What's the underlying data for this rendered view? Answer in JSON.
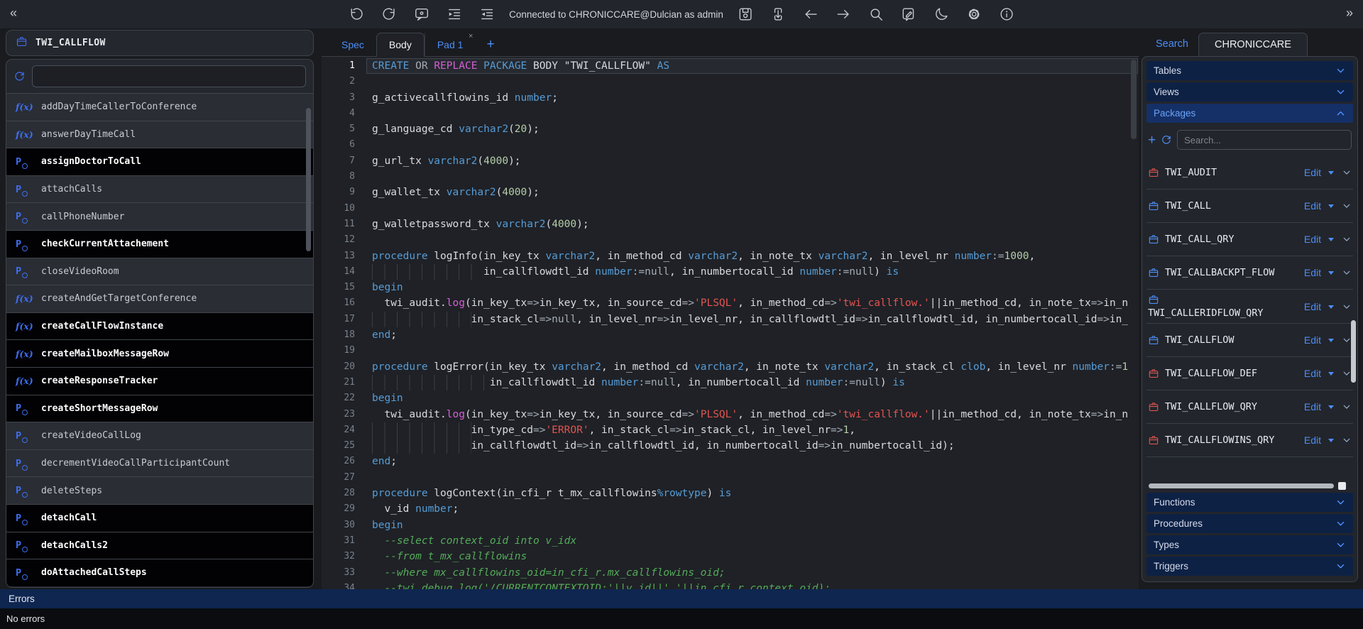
{
  "toolbar": {
    "collapse_left": "«",
    "collapse_right": "»",
    "connection_text": "Connected to CHRONICCARE@Dulcian as admin",
    "left_icons": [
      {
        "name": "undo-icon",
        "glyph": "undo"
      },
      {
        "name": "redo-icon",
        "glyph": "redo"
      },
      {
        "name": "comments-icon",
        "glyph": "comment"
      },
      {
        "name": "indent-icon",
        "glyph": "indent"
      },
      {
        "name": "outdent-icon",
        "glyph": "outdent"
      }
    ],
    "right_icons": [
      {
        "name": "save-icon",
        "glyph": "save"
      },
      {
        "name": "export-file-icon",
        "glyph": "docarrow"
      },
      {
        "name": "back-icon",
        "glyph": "arrowLeft"
      },
      {
        "name": "forward-icon",
        "glyph": "arrowRight"
      },
      {
        "name": "search-icon",
        "glyph": "search"
      },
      {
        "name": "annotate-icon",
        "glyph": "annotate"
      },
      {
        "name": "dark-mode-icon",
        "glyph": "moon"
      },
      {
        "name": "settings-icon",
        "glyph": "gear"
      },
      {
        "name": "info-icon",
        "glyph": "info"
      }
    ]
  },
  "left_panel": {
    "title": "TWI_CALLFLOW",
    "filter_value": "",
    "items": [
      {
        "label": "addDayTimeCallerToConference",
        "kind": "function",
        "emphasized": false
      },
      {
        "label": "answerDayTimeCall",
        "kind": "function",
        "emphasized": false
      },
      {
        "label": "assignDoctorToCall",
        "kind": "procedure",
        "emphasized": true
      },
      {
        "label": "attachCalls",
        "kind": "procedure",
        "emphasized": false
      },
      {
        "label": "callPhoneNumber",
        "kind": "procedure",
        "emphasized": false
      },
      {
        "label": "checkCurrentAttachement",
        "kind": "procedure",
        "emphasized": true
      },
      {
        "label": "closeVideoRoom",
        "kind": "procedure",
        "emphasized": false
      },
      {
        "label": "createAndGetTargetConference",
        "kind": "function",
        "emphasized": false
      },
      {
        "label": "createCallFlowInstance",
        "kind": "function",
        "emphasized": true
      },
      {
        "label": "createMailboxMessageRow",
        "kind": "function",
        "emphasized": true
      },
      {
        "label": "createResponseTracker",
        "kind": "function",
        "emphasized": true
      },
      {
        "label": "createShortMessageRow",
        "kind": "procedure",
        "emphasized": true
      },
      {
        "label": "createVideoCallLog",
        "kind": "procedure",
        "emphasized": false
      },
      {
        "label": "decrementVideoCallParticipantCount",
        "kind": "procedure",
        "emphasized": false
      },
      {
        "label": "deleteSteps",
        "kind": "procedure",
        "emphasized": false
      },
      {
        "label": "detachCall",
        "kind": "procedure",
        "emphasized": true
      },
      {
        "label": "detachCalls2",
        "kind": "procedure",
        "emphasized": true
      },
      {
        "label": "doAttachedCallSteps",
        "kind": "procedure",
        "emphasized": true
      }
    ]
  },
  "editor": {
    "tabs": [
      {
        "label": "Spec",
        "active": false
      },
      {
        "label": "Body",
        "active": true
      },
      {
        "label": "Pad 1",
        "active": false,
        "closable": true
      }
    ],
    "add_tab": "+",
    "close_glyph": "×",
    "lines": [
      {
        "no": 1,
        "current": true,
        "segs": [
          [
            "k",
            "CREATE"
          ],
          [
            "d",
            " "
          ],
          [
            "o",
            "OR"
          ],
          [
            "d",
            " "
          ],
          [
            "m",
            "REPLACE"
          ],
          [
            "d",
            " "
          ],
          [
            "k",
            "PACKAGE"
          ],
          [
            "d",
            " BODY \"TWI_CALLFLOW\" "
          ],
          [
            "k",
            "AS"
          ]
        ]
      },
      {
        "no": 2,
        "segs": []
      },
      {
        "no": 3,
        "segs": [
          [
            "d",
            "g_activecallflowins_id "
          ],
          [
            "k",
            "number"
          ],
          [
            "d",
            ";"
          ]
        ]
      },
      {
        "no": 4,
        "segs": []
      },
      {
        "no": 5,
        "segs": [
          [
            "d",
            "g_language_cd "
          ],
          [
            "k",
            "varchar2"
          ],
          [
            "d",
            "("
          ],
          [
            "n",
            "20"
          ],
          [
            "d",
            ");"
          ]
        ]
      },
      {
        "no": 6,
        "segs": []
      },
      {
        "no": 7,
        "segs": [
          [
            "d",
            "g_url_tx "
          ],
          [
            "k",
            "varchar2"
          ],
          [
            "d",
            "("
          ],
          [
            "n",
            "4000"
          ],
          [
            "d",
            ");"
          ]
        ]
      },
      {
        "no": 8,
        "segs": []
      },
      {
        "no": 9,
        "segs": [
          [
            "d",
            "g_wallet_tx "
          ],
          [
            "k",
            "varchar2"
          ],
          [
            "d",
            "("
          ],
          [
            "n",
            "4000"
          ],
          [
            "d",
            ");"
          ]
        ]
      },
      {
        "no": 10,
        "segs": []
      },
      {
        "no": 11,
        "segs": [
          [
            "d",
            "g_walletpassword_tx "
          ],
          [
            "k",
            "varchar2"
          ],
          [
            "d",
            "("
          ],
          [
            "n",
            "4000"
          ],
          [
            "d",
            ");"
          ]
        ]
      },
      {
        "no": 12,
        "segs": []
      },
      {
        "no": 13,
        "segs": [
          [
            "k",
            "procedure"
          ],
          [
            "d",
            " logInfo(in_key_tx "
          ],
          [
            "k",
            "varchar2"
          ],
          [
            "d",
            ", in_method_cd "
          ],
          [
            "k",
            "varchar2"
          ],
          [
            "d",
            ", in_note_tx "
          ],
          [
            "k",
            "varchar2"
          ],
          [
            "d",
            ", in_level_nr "
          ],
          [
            "k",
            "number"
          ],
          [
            "o",
            ":="
          ],
          [
            "n",
            "1000"
          ],
          [
            "d",
            ","
          ]
        ]
      },
      {
        "no": 14,
        "segs": [
          [
            "g",
            18
          ],
          [
            "d",
            "in_callflowdtl_id "
          ],
          [
            "k",
            "number"
          ],
          [
            "o",
            ":=null"
          ],
          [
            "d",
            ", in_numbertocall_id "
          ],
          [
            "k",
            "number"
          ],
          [
            "o",
            ":=null"
          ],
          [
            "d",
            ") "
          ],
          [
            "k",
            "is"
          ]
        ]
      },
      {
        "no": 15,
        "segs": [
          [
            "k",
            "begin"
          ]
        ]
      },
      {
        "no": 16,
        "segs": [
          [
            "d",
            "  twi_audit."
          ],
          [
            "m",
            "log"
          ],
          [
            "d",
            "(in_key_tx"
          ],
          [
            "o",
            "=>"
          ],
          [
            "d",
            "in_key_tx, in_source_cd"
          ],
          [
            "o",
            "=>"
          ],
          [
            "s",
            "'PLSQL'"
          ],
          [
            "d",
            ", in_method_cd"
          ],
          [
            "o",
            "=>"
          ],
          [
            "s",
            "'twi_callflow.'"
          ],
          [
            "d",
            "||in_method_cd, in_note_tx"
          ],
          [
            "o",
            "=>"
          ],
          [
            "d",
            "in_n"
          ]
        ]
      },
      {
        "no": 17,
        "segs": [
          [
            "g",
            16
          ],
          [
            "d",
            "in_stack_cl"
          ],
          [
            "o",
            "=>null"
          ],
          [
            "d",
            ", in_level_nr"
          ],
          [
            "o",
            "=>"
          ],
          [
            "d",
            "in_level_nr, in_callflowdtl_id"
          ],
          [
            "o",
            "=>"
          ],
          [
            "d",
            "in_callflowdtl_id, in_numbertocall_id"
          ],
          [
            "o",
            "=>"
          ],
          [
            "d",
            "in_"
          ]
        ]
      },
      {
        "no": 18,
        "segs": [
          [
            "k",
            "end"
          ],
          [
            "d",
            ";"
          ]
        ]
      },
      {
        "no": 19,
        "segs": []
      },
      {
        "no": 20,
        "segs": [
          [
            "k",
            "procedure"
          ],
          [
            "d",
            " logError(in_key_tx "
          ],
          [
            "k",
            "varchar2"
          ],
          [
            "d",
            ", in_method_cd "
          ],
          [
            "k",
            "varchar2"
          ],
          [
            "d",
            ", in_note_tx "
          ],
          [
            "k",
            "varchar2"
          ],
          [
            "d",
            ", in_stack_cl "
          ],
          [
            "k",
            "clob"
          ],
          [
            "d",
            ", in_level_nr "
          ],
          [
            "k",
            "number"
          ],
          [
            "o",
            ":="
          ],
          [
            "n",
            "1"
          ]
        ]
      },
      {
        "no": 21,
        "segs": [
          [
            "g",
            19
          ],
          [
            "d",
            "in_callflowdtl_id "
          ],
          [
            "k",
            "number"
          ],
          [
            "o",
            ":=null"
          ],
          [
            "d",
            ", in_numbertocall_id "
          ],
          [
            "k",
            "number"
          ],
          [
            "o",
            ":=null"
          ],
          [
            "d",
            ") "
          ],
          [
            "k",
            "is"
          ]
        ]
      },
      {
        "no": 22,
        "segs": [
          [
            "k",
            "begin"
          ]
        ]
      },
      {
        "no": 23,
        "segs": [
          [
            "d",
            "  twi_audit."
          ],
          [
            "m",
            "log"
          ],
          [
            "d",
            "(in_key_tx"
          ],
          [
            "o",
            "=>"
          ],
          [
            "d",
            "in_key_tx, in_source_cd"
          ],
          [
            "o",
            "=>"
          ],
          [
            "s",
            "'PLSQL'"
          ],
          [
            "d",
            ", in_method_cd"
          ],
          [
            "o",
            "=>"
          ],
          [
            "s",
            "'twi_callflow.'"
          ],
          [
            "d",
            "||in_method_cd, in_note_tx"
          ],
          [
            "o",
            "=>"
          ],
          [
            "d",
            "in_n"
          ]
        ]
      },
      {
        "no": 24,
        "segs": [
          [
            "g",
            16
          ],
          [
            "d",
            "in_type_cd"
          ],
          [
            "o",
            "=>"
          ],
          [
            "s",
            "'ERROR'"
          ],
          [
            "d",
            ", in_stack_cl"
          ],
          [
            "o",
            "=>"
          ],
          [
            "d",
            "in_stack_cl, in_level_nr"
          ],
          [
            "o",
            "=>"
          ],
          [
            "n",
            "1"
          ],
          [
            "d",
            ","
          ]
        ]
      },
      {
        "no": 25,
        "segs": [
          [
            "g",
            16
          ],
          [
            "d",
            "in_callflowdtl_id"
          ],
          [
            "o",
            "=>"
          ],
          [
            "d",
            "in_callflowdtl_id, in_numbertocall_id"
          ],
          [
            "o",
            "=>"
          ],
          [
            "d",
            "in_numbertocall_id);"
          ]
        ]
      },
      {
        "no": 26,
        "segs": [
          [
            "k",
            "end"
          ],
          [
            "d",
            ";"
          ]
        ]
      },
      {
        "no": 27,
        "segs": []
      },
      {
        "no": 28,
        "segs": [
          [
            "k",
            "procedure"
          ],
          [
            "d",
            " logContext(in_cfi_r t_mx_callflowins"
          ],
          [
            "k",
            "%rowtype"
          ],
          [
            "d",
            ") "
          ],
          [
            "k",
            "is"
          ]
        ]
      },
      {
        "no": 29,
        "segs": [
          [
            "d",
            "  v_id "
          ],
          [
            "k",
            "number"
          ],
          [
            "d",
            ";"
          ]
        ]
      },
      {
        "no": 30,
        "segs": [
          [
            "k",
            "begin"
          ]
        ]
      },
      {
        "no": 31,
        "segs": [
          [
            "c",
            "  --select context_oid into v_idx"
          ]
        ]
      },
      {
        "no": 32,
        "segs": [
          [
            "c",
            "  --from t_mx_callflowins"
          ]
        ]
      },
      {
        "no": 33,
        "segs": [
          [
            "c",
            "  --where mx_callflowins_oid=in_cfi_r.mx_callflowins_oid;"
          ]
        ]
      },
      {
        "no": 34,
        "segs": [
          [
            "c",
            "  --twi_debug.log('/CURRENTCONTEXTOID:'||v_id||' '||in_cfi_r.context_oid);"
          ]
        ]
      }
    ]
  },
  "right_panel": {
    "tabs": [
      {
        "label": "Search",
        "active": false
      },
      {
        "label": "CHRONICCARE",
        "active": true
      }
    ],
    "sections_top": [
      {
        "label": "Tables",
        "expanded": false
      },
      {
        "label": "Views",
        "expanded": false
      },
      {
        "label": "Packages",
        "expanded": true
      }
    ],
    "search_placeholder": "Search...",
    "add_label": "+",
    "edit_label": "Edit",
    "packages": [
      {
        "name": "TWI_AUDIT",
        "color": "red",
        "wrap": false
      },
      {
        "name": "TWI_CALL",
        "color": "blue",
        "wrap": false
      },
      {
        "name": "TWI_CALL_QRY",
        "color": "blue",
        "wrap": false
      },
      {
        "name": "TWI_CALLBACKPT_FLOW",
        "color": "blue",
        "wrap": false
      },
      {
        "name": "TWI_CALLERIDFLOW_QRY",
        "color": "blue",
        "wrap": true
      },
      {
        "name": "TWI_CALLFLOW",
        "color": "blue",
        "wrap": false
      },
      {
        "name": "TWI_CALLFLOW_DEF",
        "color": "red",
        "wrap": false
      },
      {
        "name": "TWI_CALLFLOW_QRY",
        "color": "red",
        "wrap": false
      },
      {
        "name": "TWI_CALLFLOWINS_QRY",
        "color": "red",
        "wrap": false
      }
    ],
    "sections_bottom": [
      {
        "label": "Functions"
      },
      {
        "label": "Procedures"
      },
      {
        "label": "Types"
      },
      {
        "label": "Triggers"
      }
    ]
  },
  "status": {
    "errors_title": "Errors",
    "errors_value": "No errors"
  },
  "colors": {
    "accent_blue": "#4d8df7",
    "keyword_blue": "#569cd6",
    "string_red": "#e25450",
    "number_green": "#b5cea8",
    "comment_green": "#55ab5a",
    "magenta": "#d65fd6",
    "package_icon_red": "#d95450",
    "header_navy": "#0d2145",
    "header_navy_active": "#153067"
  }
}
